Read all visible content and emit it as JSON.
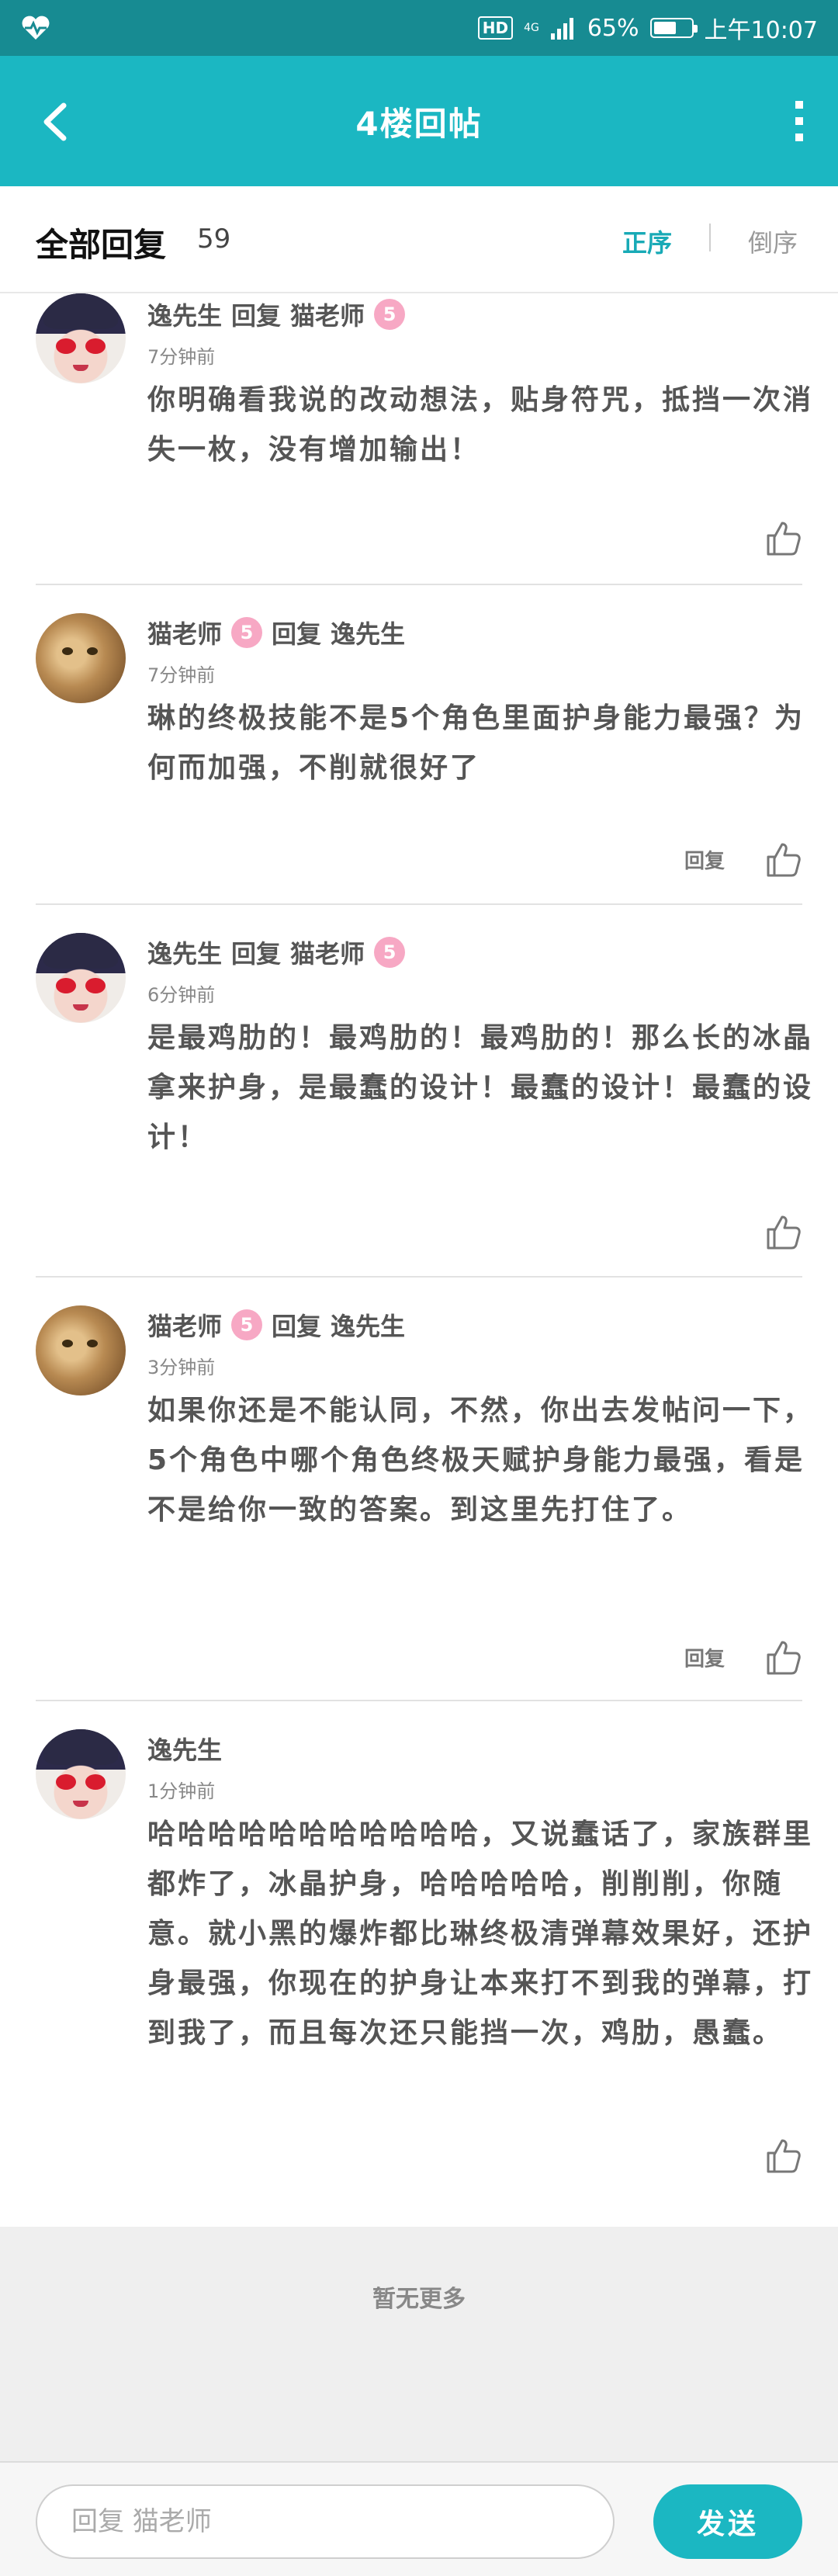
{
  "status_bar": {
    "network_type": "4G",
    "network_sub": "46",
    "battery_percent": "65%",
    "battery_level": 0.65,
    "time": "上午10:07",
    "hd_label": "HD"
  },
  "header": {
    "title": "4楼回帖"
  },
  "sort_bar": {
    "title": "全部回复",
    "count": "59",
    "asc_label": "正序",
    "desc_label": "倒序"
  },
  "replies": [
    {
      "author": "逸先生",
      "reply_word": "回复",
      "target": "猫老师",
      "level": "5",
      "time": "7分钟前",
      "content": "你明确看我说的改动想法，贴身符咒，抵挡一次消失一枚，没有增加输出！",
      "has_reply_link": false
    },
    {
      "author": "猫老师",
      "level": "5",
      "reply_word": "回复",
      "target": "逸先生",
      "time": "7分钟前",
      "content": "琳的终极技能不是5个角色里面护身能力最强？为何而加强，不削就很好了",
      "reply_label": "回复",
      "has_reply_link": true
    },
    {
      "author": "逸先生",
      "reply_word": "回复",
      "target": "猫老师",
      "level": "5",
      "time": "6分钟前",
      "content": "是最鸡肋的！最鸡肋的！最鸡肋的！那么长的冰晶拿来护身，是最蠢的设计！最蠢的设计！最蠢的设计！",
      "has_reply_link": false
    },
    {
      "author": "猫老师",
      "level": "5",
      "reply_word": "回复",
      "target": "逸先生",
      "time": "3分钟前",
      "content": "如果你还是不能认同，不然，你出去发帖问一下，5个角色中哪个角色终极天赋护身能力最强，看是不是给你一致的答案。到这里先打住了。",
      "reply_label": "回复",
      "has_reply_link": true
    },
    {
      "author": "逸先生",
      "time": "1分钟前",
      "content": "哈哈哈哈哈哈哈哈哈哈哈，又说蠢话了，家族群里都炸了，冰晶护身，哈哈哈哈哈，削削削，你随意。就小黑的爆炸都比琳终极清弹幕效果好，还护身最强，你现在的护身让本来打不到我的弹幕，打到我了，而且每次还只能挡一次，鸡肋，愚蠢。",
      "has_reply_link": false
    }
  ],
  "no_more": "暂无更多",
  "bottom_bar": {
    "placeholder": "回复 猫老师",
    "send_label": "发送"
  },
  "colors": {
    "status_bar": "#178b92",
    "header": "#1bb7c2",
    "accent": "#18aab6",
    "level_badge": "#f7a8c4"
  }
}
